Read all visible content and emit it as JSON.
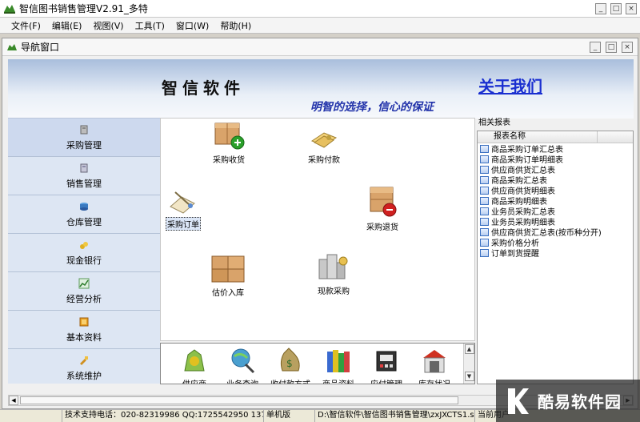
{
  "window": {
    "title": "智信图书销售管理V2.91_多特",
    "controls": [
      "minimize",
      "restore",
      "close"
    ]
  },
  "menu": [
    "文件(F)",
    "编辑(E)",
    "视图(V)",
    "工具(T)",
    "窗口(W)",
    "帮助(H)"
  ],
  "nav_window": {
    "title": "导航窗口"
  },
  "banner": {
    "brand": "智信软件",
    "about": "关于我们",
    "slogan": "明智的选择，信心的保证"
  },
  "left_nav": [
    {
      "label": "采购管理",
      "icon": "purchase-icon",
      "active": true
    },
    {
      "label": "销售管理",
      "icon": "sales-icon",
      "active": false
    },
    {
      "label": "仓库管理",
      "icon": "warehouse-icon",
      "active": false
    },
    {
      "label": "现金银行",
      "icon": "cash-bank-icon",
      "active": false
    },
    {
      "label": "经营分析",
      "icon": "analysis-icon",
      "active": false
    },
    {
      "label": "基本资料",
      "icon": "basic-data-icon",
      "active": false
    },
    {
      "label": "系统维护",
      "icon": "system-icon",
      "active": false
    }
  ],
  "flow": {
    "purchase_receive": "采购收货",
    "purchase_pay": "采购付款",
    "purchase_order": "采购订单",
    "purchase_return": "采购退货",
    "estimate_stock_in": "估价入库",
    "cash_purchase": "现款采购"
  },
  "bottom_strip": [
    "供应商",
    "业务查询",
    "收付款方式",
    "商品资料",
    "应付管理",
    "库存状况"
  ],
  "right_panel": {
    "title": "相关报表",
    "column": "报表名称",
    "reports": [
      "商品采购订单汇总表",
      "商品采购订单明细表",
      "供应商供货汇总表",
      "商品采购汇总表",
      "供应商供货明细表",
      "商品采购明细表",
      "业务员采购汇总表",
      "业务员采购明细表",
      "供应商供货汇总表(按币种分开)",
      "采购价格分析",
      "订单到货提醒"
    ]
  },
  "status": {
    "support": "技术支持电话：020-82319986 QQ:1725542950 137028856",
    "mode": "单机版",
    "path": "D:\\智信软件\\智信图书销售管理\\zxJXCTS1.sys",
    "current": "当前用户"
  },
  "watermark": {
    "text": "酷易软件园"
  },
  "colors": {
    "brand_blue": "#1a2fd0",
    "slogan_blue": "#2233aa",
    "nav_bg": "#dde6f3"
  }
}
